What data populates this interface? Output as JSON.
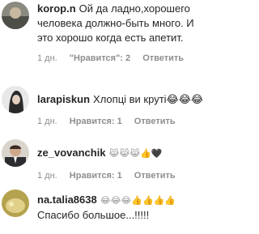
{
  "comments": [
    {
      "username": "korop.n",
      "text": "Ой да ладно,хорошего человека должно-быть много. И это хорошо когда есть апетит.",
      "time": "1 дн.",
      "likes": "\"Нравится\": 2",
      "reply": "Ответить",
      "avatar_color": "#7a7a72"
    },
    {
      "username": "larapiskun",
      "text": "Хлопці ви круті😂😂😂",
      "time": "1 дн.",
      "likes": "Нравится: 1",
      "reply": "Ответить",
      "avatar_color": "#3c3a3a"
    },
    {
      "username": "ze_vovanchik",
      "text": "😹😹😹👍🖤",
      "time": "1 дн.",
      "likes": "Нравится: 1",
      "reply": "Ответить",
      "avatar_color": "#5a4a40"
    },
    {
      "username": "na.talia8638",
      "text": "😂😂😂👍👍👍👍",
      "text2": "Спасибо большое...!!!!!",
      "time": "1 дн.",
      "likes": "Нравится: 1",
      "reply": "Ответить",
      "avatar_color": "#c8b468"
    }
  ]
}
